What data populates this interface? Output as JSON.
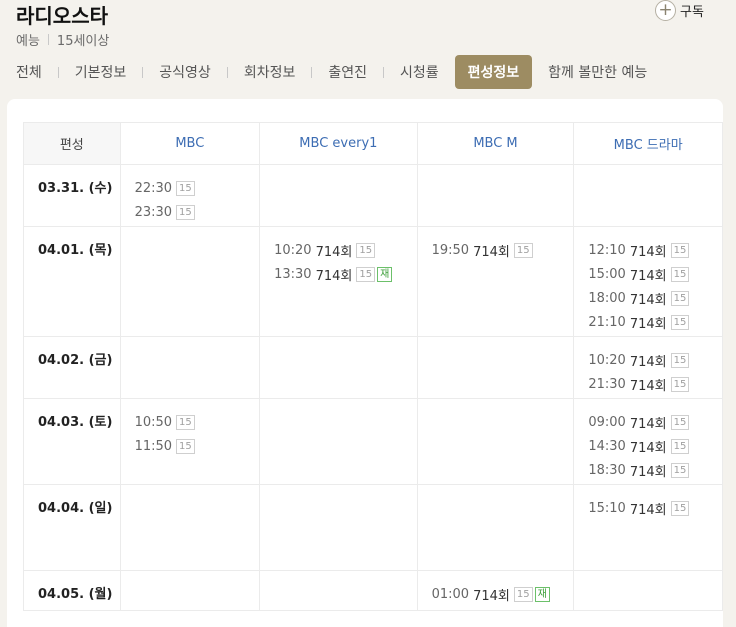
{
  "header": {
    "title": "라디오스타",
    "subscribe_label": "구독",
    "genre": "예능",
    "rating": "15세이상"
  },
  "tabs": [
    {
      "label": "전체",
      "active": false
    },
    {
      "label": "기본정보",
      "active": false
    },
    {
      "label": "공식영상",
      "active": false
    },
    {
      "label": "회차정보",
      "active": false
    },
    {
      "label": "출연진",
      "active": false
    },
    {
      "label": "시청률",
      "active": false
    },
    {
      "label": "편성정보",
      "active": true
    },
    {
      "label": "함께 볼만한 예능",
      "active": false
    }
  ],
  "schedule": {
    "corner_label": "편성",
    "channels": [
      "MBC",
      "MBC every1",
      "MBC M",
      "MBC 드라마"
    ],
    "badge_rating": "15",
    "badge_rerun": "재",
    "rows": [
      {
        "date": "03.31. (수)",
        "cells": [
          [
            {
              "time": "22:30",
              "ep": ""
            },
            {
              "time": "23:30",
              "ep": ""
            }
          ],
          [],
          [],
          []
        ]
      },
      {
        "date": "04.01. (목)",
        "cells": [
          [],
          [
            {
              "time": "10:20",
              "ep": "714회"
            },
            {
              "time": "13:30",
              "ep": "714회",
              "rerun": true
            }
          ],
          [
            {
              "time": "19:50",
              "ep": "714회"
            }
          ],
          [
            {
              "time": "12:10",
              "ep": "714회"
            },
            {
              "time": "15:00",
              "ep": "714회"
            },
            {
              "time": "18:00",
              "ep": "714회"
            },
            {
              "time": "21:10",
              "ep": "714회"
            }
          ]
        ]
      },
      {
        "date": "04.02. (금)",
        "cells": [
          [],
          [],
          [],
          [
            {
              "time": "10:20",
              "ep": "714회"
            },
            {
              "time": "21:30",
              "ep": "714회"
            }
          ]
        ]
      },
      {
        "date": "04.03. (토)",
        "cells": [
          [
            {
              "time": "10:50",
              "ep": ""
            },
            {
              "time": "11:50",
              "ep": ""
            }
          ],
          [],
          [],
          [
            {
              "time": "09:00",
              "ep": "714회"
            },
            {
              "time": "14:30",
              "ep": "714회"
            },
            {
              "time": "18:30",
              "ep": "714회"
            }
          ]
        ]
      },
      {
        "date": "04.04. (일)",
        "cells": [
          [],
          [],
          [],
          [
            {
              "time": "15:10",
              "ep": "714회"
            }
          ]
        ]
      },
      {
        "date": "04.05. (월)",
        "cells": [
          [],
          [],
          [
            {
              "time": "01:00",
              "ep": "714회",
              "rerun": true
            }
          ],
          []
        ]
      }
    ]
  }
}
